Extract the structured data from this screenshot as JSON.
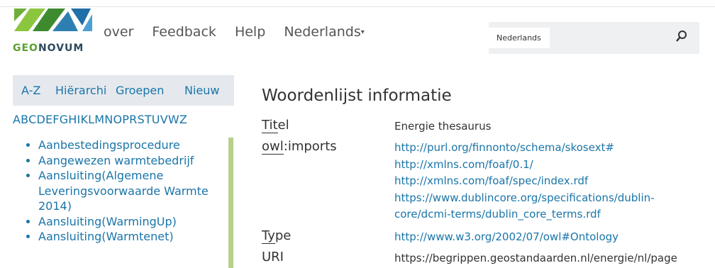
{
  "logo": {
    "geo": "GEO",
    "rest": "NOVUM"
  },
  "topnav": {
    "over": "over",
    "feedback": "Feedback",
    "help": "Help",
    "language": "Nederlands"
  },
  "search": {
    "lang_button": "Nederlands",
    "icon": "search-icon"
  },
  "sidebar": {
    "tabs": [
      "A-Z",
      "Hiërarchi",
      "Groepen",
      "Nieuw"
    ],
    "letters": [
      "A",
      "B",
      "C",
      "D",
      "E",
      "F",
      "G",
      "H",
      "I",
      "K",
      "L",
      "M",
      "N",
      "O",
      "P",
      "R",
      "S",
      "T",
      "U",
      "V",
      "W",
      "Z"
    ],
    "items": [
      "Aanbestedingsprocedure",
      "Aangewezen warmtebedrijf",
      "Aansluiting(Algemene Leveringsvoorwaarde Warmte 2014)",
      "Aansluiting(WarmingUp)",
      "Aansluiting(Warmtenet)"
    ]
  },
  "main": {
    "title": "Woordenlijst informatie",
    "rows": [
      {
        "label_u": "Tit",
        "label_rest": "el",
        "values": [
          "Energie thesaurus"
        ],
        "link": false
      },
      {
        "label_u": "owl",
        "label_rest": ":imports",
        "values": [
          "http://purl.org/finnonto/schema/skosext#",
          "http://xmlns.com/foaf/0.1/",
          "http://xmlns.com/foaf/spec/index.rdf",
          "https://www.dublincore.org/specifications/dublin-",
          "core/dcmi-terms/dublin_core_terms.rdf"
        ],
        "link": true
      },
      {
        "label_u": "Ty",
        "label_rest": "pe",
        "values": [
          "http://www.w3.org/2002/07/owl#Ontology"
        ],
        "link": true
      },
      {
        "label_u": "",
        "label_rest": "URI",
        "values": [
          "https://begrippen.geostandaarden.nl/energie/nl/page"
        ],
        "link": false
      }
    ]
  }
}
